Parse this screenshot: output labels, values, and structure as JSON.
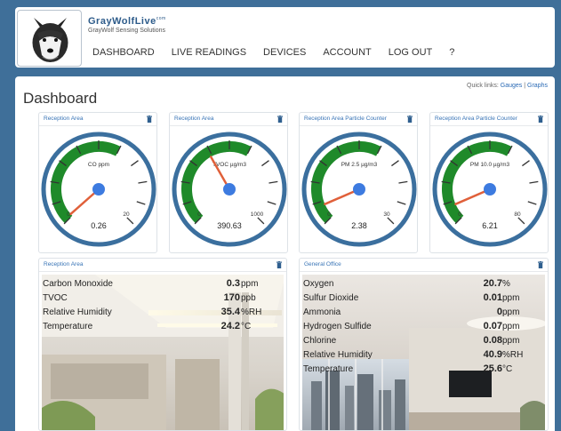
{
  "header": {
    "brand_name": "GrayWolfLive",
    "brand_tm": "com",
    "brand_subtitle": "GrayWolf Sensing Solutions",
    "nav": [
      "DASHBOARD",
      "LIVE READINGS",
      "DEVICES",
      "ACCOUNT",
      "LOG OUT",
      "?"
    ]
  },
  "page": {
    "title": "Dashboard",
    "quick_links_label": "Quick links:",
    "quick_link_gauges": "Gauges",
    "quick_link_separator": "|",
    "quick_link_graphs": "Graphs"
  },
  "gauges": [
    {
      "location": "Reception Area",
      "label": "CO ppm",
      "min": "0",
      "max": "20",
      "value": "0.26",
      "level": 0.013
    },
    {
      "location": "Reception Area",
      "label": "TVOC µg/m3",
      "min": "0",
      "max": "1000",
      "value": "390.63",
      "level": 0.39
    },
    {
      "location": "Reception Area Particle Counter",
      "label": "PM 2.5 µg/m3",
      "min": "0",
      "max": "30",
      "value": "2.38",
      "level": 0.08
    },
    {
      "location": "Reception Area Particle Counter",
      "label": "PM 10.0 µg/m3",
      "min": "0",
      "max": "80",
      "value": "6.21",
      "level": 0.08
    }
  ],
  "panels": [
    {
      "location": "Reception Area",
      "readings": [
        {
          "name": "Carbon Monoxide",
          "value": "0.3",
          "unit": "ppm"
        },
        {
          "name": "TVOC",
          "value": "170",
          "unit": "ppb"
        },
        {
          "name": "Relative Humidity",
          "value": "35.4",
          "unit": "%RH"
        },
        {
          "name": "Temperature",
          "value": "24.2",
          "unit": "°C"
        }
      ]
    },
    {
      "location": "General Office",
      "readings": [
        {
          "name": "Oxygen",
          "value": "20.7",
          "unit": "%"
        },
        {
          "name": "Sulfur Dioxide",
          "value": "0.01",
          "unit": "ppm"
        },
        {
          "name": "Ammonia",
          "value": "0",
          "unit": "ppm"
        },
        {
          "name": "Hydrogen Sulfide",
          "value": "0.07",
          "unit": "ppm"
        },
        {
          "name": "Chlorine",
          "value": "0.08",
          "unit": "ppm"
        },
        {
          "name": "Relative Humidity",
          "value": "40.9",
          "unit": "%RH"
        },
        {
          "name": "Temperature",
          "value": "25.6",
          "unit": "°C"
        }
      ]
    }
  ],
  "colors": {
    "background": "#3f6f99",
    "gauge_ring": "#3b6f9e",
    "gauge_green": "#1f8a2a",
    "needle": "#e0603a",
    "hub": "#3d7be0",
    "link": "#3874b6"
  }
}
